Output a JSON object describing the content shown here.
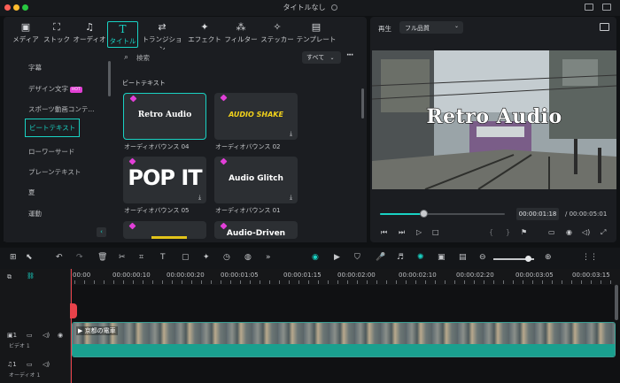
{
  "window": {
    "title": "タイトルなし"
  },
  "tabs": [
    {
      "label": "メディア",
      "icon": "media-icon",
      "glyph": "▣"
    },
    {
      "label": "ストック",
      "icon": "stock-icon",
      "glyph": "⛶"
    },
    {
      "label": "オーディオ",
      "icon": "music-note-icon",
      "glyph": "♫"
    },
    {
      "label": "タイトル",
      "icon": "title-icon",
      "glyph": "T"
    },
    {
      "label": "トランジション",
      "icon": "transition-icon",
      "glyph": "⇄"
    },
    {
      "label": "エフェクト",
      "icon": "effect-icon",
      "glyph": "✦"
    },
    {
      "label": "フィルター",
      "icon": "filter-icon",
      "glyph": "⁂"
    },
    {
      "label": "ステッカー",
      "icon": "sticker-icon",
      "glyph": "✧"
    },
    {
      "label": "テンプレート",
      "icon": "template-icon",
      "glyph": "▤"
    }
  ],
  "categories": {
    "items": [
      "字幕",
      "デザイン文字",
      "スポーツ動画コンテ...",
      "ビートテキスト",
      "ローワーサード",
      "プレーンテキスト",
      "夏",
      "運動"
    ],
    "hot_badge": "HOT"
  },
  "search": {
    "placeholder": "検索"
  },
  "filter": {
    "value": "すべて"
  },
  "section": {
    "title": "ビートテキスト"
  },
  "cards": [
    {
      "text": "Retro Audio",
      "caption": "オーディオバウンス 04"
    },
    {
      "text": "AUDIO SHAKE",
      "caption": "オーディオバウンス 02"
    },
    {
      "text": "POP IT",
      "caption": "オーディオバウンス 05"
    },
    {
      "text": "Audio Glitch",
      "caption": "オーディオバウンス 01"
    },
    {
      "text": "",
      "caption": ""
    },
    {
      "text": "Audio-Driven",
      "caption": ""
    }
  ],
  "preview": {
    "label": "再生",
    "quality": "フル品質",
    "overlay_text": "Retro Audio",
    "current_time": "00:00:01:18",
    "total_time": "/ 00:00:05:01",
    "progress": 0.35
  },
  "timeline": {
    "ruler": [
      "00:00",
      "00:00:00:10",
      "00:00:00:20",
      "00:00:01:05",
      "00:00:01:15",
      "00:00:02:00",
      "00:00:02:10",
      "00:00:02:20",
      "00:00:03:05",
      "00:00:03:15"
    ],
    "tracks": [
      {
        "index": "1",
        "name": "ビデオ 1"
      },
      {
        "index": "1",
        "name": "オーディオ 1"
      }
    ],
    "clip_label": "京都の電車",
    "zoom": 0.85
  },
  "colors": {
    "accent": "#19d2c3",
    "playhead": "#e8424a",
    "hot": "#e03fd3",
    "audio_clip": "#1aa08f"
  }
}
